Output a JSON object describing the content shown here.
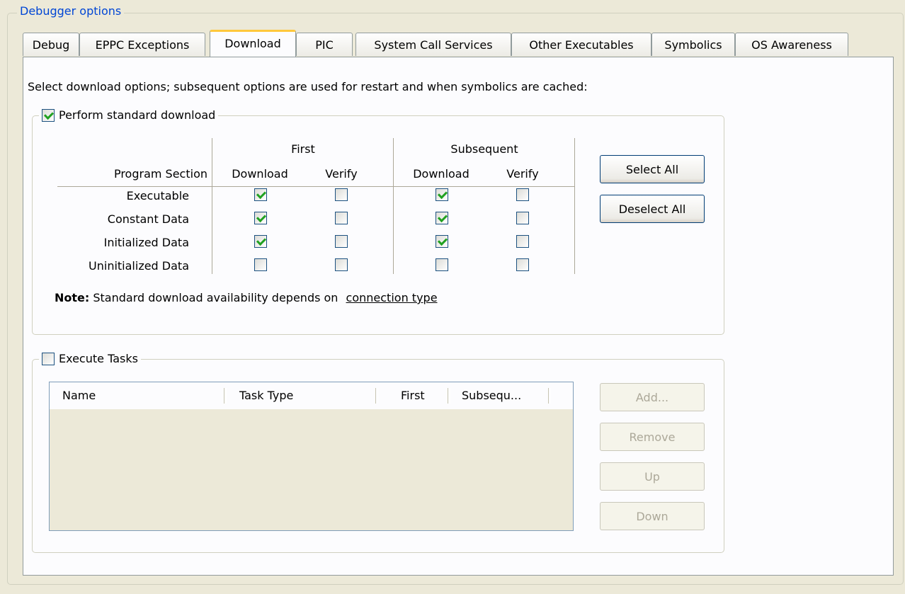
{
  "group_title": "Debugger options",
  "tabs": [
    {
      "label": "Debug"
    },
    {
      "label": "EPPC Exceptions"
    },
    {
      "label": "Download"
    },
    {
      "label": "PIC"
    },
    {
      "label": "System Call Services"
    },
    {
      "label": "Other Executables"
    },
    {
      "label": "Symbolics"
    },
    {
      "label": "OS Awareness"
    }
  ],
  "active_tab": "Download",
  "instructions": "Select download options; subsequent options are used for restart and when symbolics are cached:",
  "standard_download": {
    "label": "Perform standard download",
    "checked": true,
    "headers": {
      "program_section": "Program Section",
      "first": "First",
      "subsequent": "Subsequent",
      "download": "Download",
      "verify": "Verify"
    },
    "rows": [
      {
        "label": "Executable",
        "first_download": true,
        "first_verify": false,
        "sub_download": true,
        "sub_verify": false
      },
      {
        "label": "Constant Data",
        "first_download": true,
        "first_verify": false,
        "sub_download": true,
        "sub_verify": false
      },
      {
        "label": "Initialized Data",
        "first_download": true,
        "first_verify": false,
        "sub_download": true,
        "sub_verify": false
      },
      {
        "label": "Uninitialized Data",
        "first_download": false,
        "first_verify": false,
        "sub_download": false,
        "sub_verify": false
      }
    ],
    "select_all_label": "Select All",
    "deselect_all_label": "Deselect All",
    "note_label": "Note:",
    "note_text": "Standard download availability depends on",
    "note_link": "connection type"
  },
  "execute_tasks": {
    "label": "Execute Tasks",
    "checked": false,
    "columns": [
      "Name",
      "Task Type",
      "First",
      "Subsequ..."
    ],
    "buttons": {
      "add": "Add...",
      "remove": "Remove",
      "up": "Up",
      "down": "Down"
    }
  },
  "colors": {
    "window_bg": "#ece9d8",
    "panel_bg": "#fcfcfe",
    "group_title": "#0046d5",
    "active_tab_accent": "#ffc83c",
    "check_mark": "#21a121"
  }
}
